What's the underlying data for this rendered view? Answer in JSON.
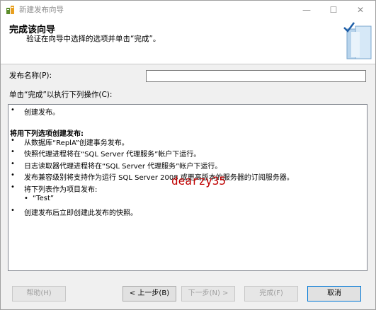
{
  "window": {
    "title": "新建发布向导",
    "minimize_glyph": "—",
    "maximize_glyph": "☐",
    "close_glyph": "✕"
  },
  "header": {
    "title": "完成该向导",
    "subtitle": "验证在向导中选择的选项并单击“完成”。"
  },
  "form": {
    "publication_name_label": "发布名称(P):",
    "publication_name_value": "",
    "action_label": "单击“完成”以执行下列操作(C):"
  },
  "summary": {
    "first_item": "创建发布。",
    "section_heading": "将用下列选项创建发布:",
    "items": [
      "从数据库“ReplA”创建事务发布。",
      "快照代理进程将在“SQL Server 代理服务”帐户下运行。",
      "日志读取器代理进程将在“SQL Server 代理服务”帐户下运行。",
      "发布兼容级别将支持作为运行 SQL Server 2008 或更高版本的服务器的订阅服务器。",
      "将下列表作为项目发布:"
    ],
    "article": "“Test”",
    "last_item": "创建发布后立即创建此发布的快照。",
    "bullet": "•",
    "sub_bullet": "•"
  },
  "watermark": "dearzy35",
  "buttons": {
    "help": "帮助(H)",
    "back": "< 上一步(B)",
    "next": "下一步(N) >",
    "finish": "完成(F)",
    "cancel": "取消"
  },
  "icons": {
    "app": "wizard-app-icon",
    "header_graphic": "book-check-icon"
  },
  "colors": {
    "watermark": "#c00000",
    "accent_border": "#0078d7",
    "disabled_text": "#a0a0a0"
  }
}
